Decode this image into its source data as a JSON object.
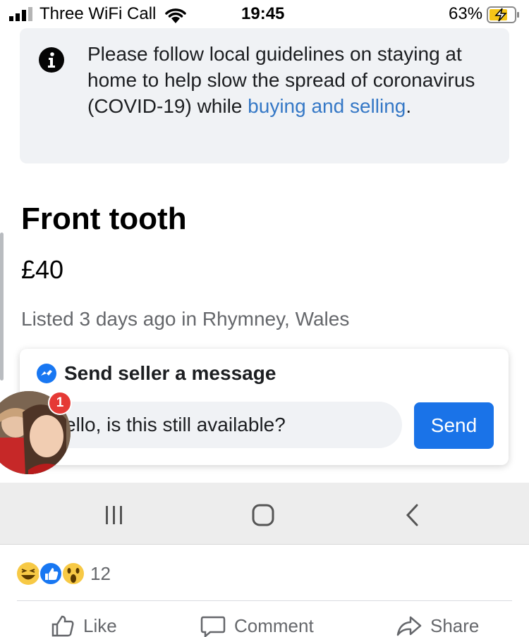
{
  "status_bar": {
    "carrier": "Three WiFi Call",
    "time": "19:45",
    "battery": "63%"
  },
  "notice": {
    "text": "Please follow local guidelines on staying at home to help slow the spread of coronavirus (COVID-19) while ",
    "link": "buying and selling",
    "suffix": "."
  },
  "listing": {
    "title": "Front tooth",
    "price": "£40",
    "listed": "Listed 3 days ago in Rhymney, Wales"
  },
  "message": {
    "heading": "Send seller a message",
    "input_value": "ello, is this still available?",
    "send_label": "Send"
  },
  "chat_head": {
    "badge": "1"
  },
  "post": {
    "reaction_count": "12",
    "actions": [
      "Like",
      "Comment",
      "Share"
    ]
  },
  "colors": {
    "link": "#3578c6",
    "send_button": "#1a73e8",
    "badge": "#e53935"
  }
}
